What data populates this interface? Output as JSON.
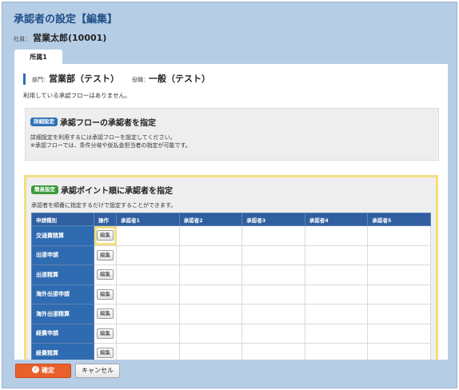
{
  "page": {
    "title": "承認者の設定【編集】",
    "employee_label": "社員：",
    "employee_value": "営業太郎(10001)"
  },
  "tabs": [
    {
      "label": "所属1",
      "active": true
    }
  ],
  "affiliation": {
    "dept_label": "部門：",
    "dept_value": "営業部（テスト）",
    "position_label": "役職：",
    "position_value": "一般（テスト）",
    "note": "利用している承認フローはありません。"
  },
  "detail_setting": {
    "badge": "詳細設定",
    "title": "承認フローの承認者を指定",
    "line1": "詳細設定を利用するには承認フローを設定してください。",
    "line2": "※承認フローでは、条件分岐や仮払金担当者の指定が可能です。"
  },
  "simple_setting": {
    "badge": "簡易設定",
    "title": "承認ポイント順に承認者を指定",
    "description": "承認者を順番に指定するだけで設定することができます。",
    "columns": [
      "申請種別",
      "操作",
      "承認者1",
      "承認者2",
      "承認者3",
      "承認者4",
      "承認者5"
    ],
    "edit_label": "編集",
    "rows": [
      {
        "kind": "交通費精算"
      },
      {
        "kind": "出張申請"
      },
      {
        "kind": "出張精算"
      },
      {
        "kind": "海外出張申請"
      },
      {
        "kind": "海外出張精算"
      },
      {
        "kind": "経費申請"
      },
      {
        "kind": "経費精算"
      }
    ]
  },
  "footer": {
    "confirm_label": "確定",
    "cancel_label": "キャンセル"
  },
  "colors": {
    "accent": "#e8602c",
    "header_blue": "#2f5f9f",
    "highlight": "#f3df83",
    "background": "#b6cde6"
  }
}
